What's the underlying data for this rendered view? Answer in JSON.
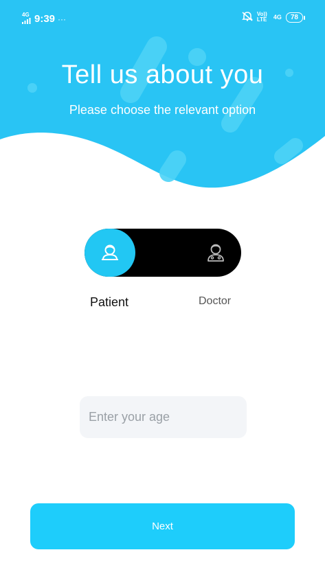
{
  "status_bar": {
    "network_type": "4G",
    "time": "9:39",
    "more_indicator": "···",
    "volte_label": "Vo)) LTE",
    "data_label": "4G",
    "battery_level": "78",
    "icons": [
      "signal-icon",
      "mute-bell-icon"
    ]
  },
  "header": {
    "title": "Tell us about you",
    "subtitle": "Please choose the relevant option"
  },
  "role_toggle": {
    "selected": "Patient",
    "options": [
      {
        "label": "Patient",
        "icon": "patient-icon"
      },
      {
        "label": "Doctor",
        "icon": "doctor-icon"
      }
    ]
  },
  "age_field": {
    "placeholder": "Enter your age",
    "value": ""
  },
  "next_button": {
    "label": "Next"
  },
  "colors": {
    "primary": "#22c7f3",
    "button": "#1ecdfb",
    "toggle_bg": "#000000",
    "input_bg": "#f3f5f8"
  }
}
